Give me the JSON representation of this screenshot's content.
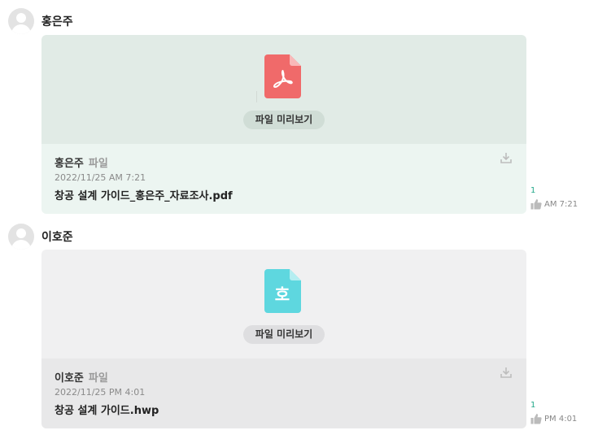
{
  "messages": [
    {
      "sender": "홍은주",
      "file_type_label": "파일",
      "date": "2022/11/25 AM 7:21",
      "file_name": "창공 설계 가이드_홍은주_자료조사.pdf",
      "preview_label": "파일 미리보기",
      "file_icon": "pdf-file-icon",
      "icon_color": "#f06a6a",
      "like_count": "1",
      "time": "AM 7:21"
    },
    {
      "sender": "이호준",
      "file_type_label": "파일",
      "date": "2022/11/25 PM 4:01",
      "file_name": "창공 설계 가이드.hwp",
      "preview_label": "파일 미리보기",
      "file_icon": "hwp-file-icon",
      "icon_glyph": "호",
      "icon_color": "#5ed7df",
      "like_count": "1",
      "time": "PM 4:01"
    }
  ],
  "colors": {
    "accent_count": "#23a88a",
    "card1_top": "#e1ebe6",
    "card1_bottom": "#ecf5f1",
    "card2_top": "#f0f0f1",
    "card2_bottom": "#e8e8e9"
  }
}
